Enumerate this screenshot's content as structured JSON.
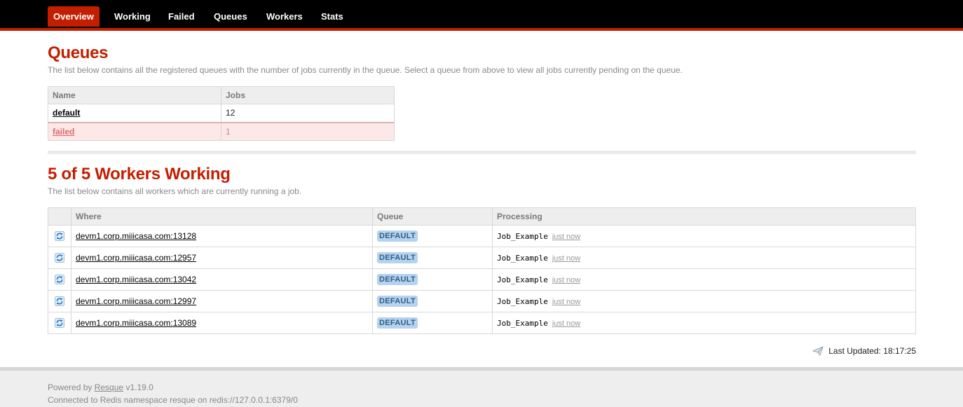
{
  "nav": {
    "tabs": [
      "Overview",
      "Working",
      "Failed",
      "Queues",
      "Workers",
      "Stats"
    ],
    "active": "Overview"
  },
  "queues": {
    "title": "Queues",
    "description": "The list below contains all the registered queues with the number of jobs currently in the queue. Select a queue from above to view all jobs currently pending on the queue.",
    "columns": [
      "Name",
      "Jobs"
    ],
    "rows": [
      {
        "name": "default",
        "jobs": "12"
      },
      {
        "name": "failed",
        "jobs": "1"
      }
    ]
  },
  "workers": {
    "title": "5 of 5 Workers Working",
    "description": "The list below contains all workers which are currently running a job.",
    "columns": [
      "",
      "Where",
      "Queue",
      "Processing"
    ],
    "rows": [
      {
        "where": "devm1.corp.miiicasa.com:13128",
        "queue": "DEFAULT",
        "job": "Job_Example",
        "time": "just now"
      },
      {
        "where": "devm1.corp.miiicasa.com:12957",
        "queue": "DEFAULT",
        "job": "Job_Example",
        "time": "just now"
      },
      {
        "where": "devm1.corp.miiicasa.com:13042",
        "queue": "DEFAULT",
        "job": "Job_Example",
        "time": "just now"
      },
      {
        "where": "devm1.corp.miiicasa.com:12997",
        "queue": "DEFAULT",
        "job": "Job_Example",
        "time": "just now"
      },
      {
        "where": "devm1.corp.miiicasa.com:13089",
        "queue": "DEFAULT",
        "job": "Job_Example",
        "time": "just now"
      }
    ]
  },
  "status": {
    "last_updated_label": "Last Updated:",
    "last_updated_time": "18:17:25"
  },
  "footer": {
    "powered_prefix": "Powered by",
    "powered_link": "Resque",
    "version": "v1.19.0",
    "connection": "Connected to Redis namespace resque on redis://127.0.0.1:6379/0"
  },
  "colors": {
    "accent": "#c41e00",
    "badge_bg": "#b6d2ec",
    "badge_text": "#2c5f8c"
  },
  "icons": [
    "refresh-icon",
    "paper-plane-icon"
  ]
}
